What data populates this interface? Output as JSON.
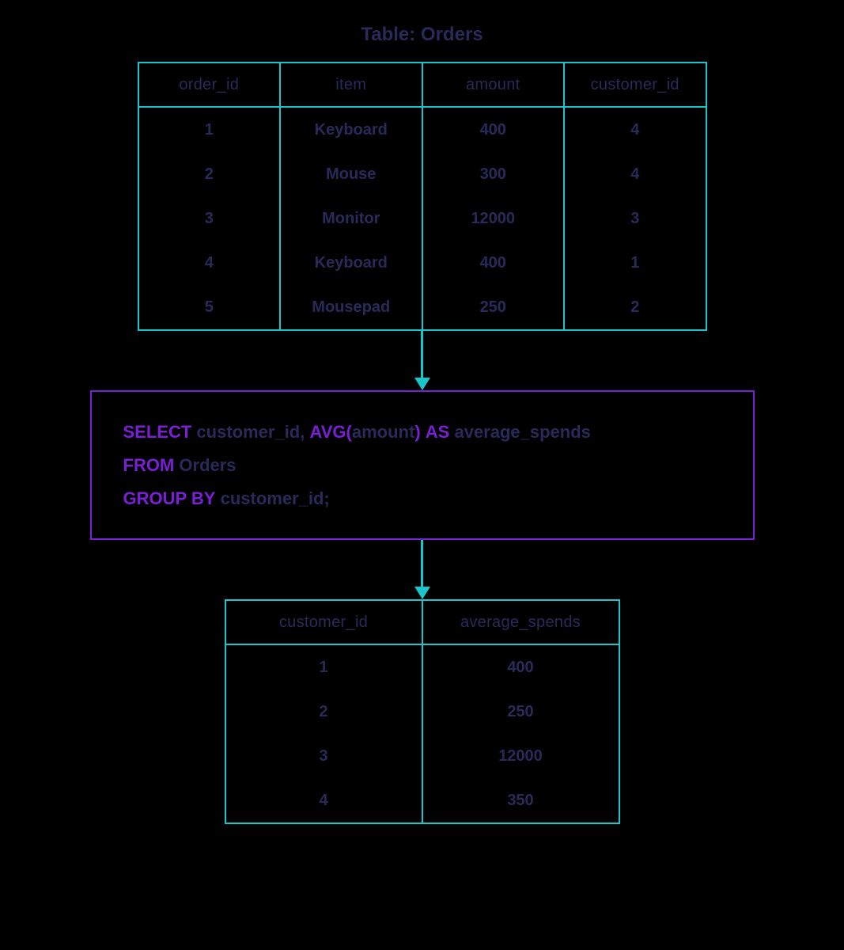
{
  "title": "Table: Orders",
  "orders_table": {
    "headers": [
      "order_id",
      "item",
      "amount",
      "customer_id"
    ],
    "rows": [
      [
        "1",
        "Keyboard",
        "400",
        "4"
      ],
      [
        "2",
        "Mouse",
        "300",
        "4"
      ],
      [
        "3",
        "Monitor",
        "12000",
        "3"
      ],
      [
        "4",
        "Keyboard",
        "400",
        "1"
      ],
      [
        "5",
        "Mousepad",
        "250",
        "2"
      ]
    ]
  },
  "sql": {
    "kw_select": "SELECT",
    "part1": "customer_id,",
    "kw_avg": "AVG",
    "part_open": "(",
    "part2": "amount",
    "part_close": ")",
    "kw_as": "AS",
    "part3": "average_spends",
    "kw_from": "FROM",
    "part4": "Orders",
    "kw_groupby": "GROUP BY",
    "part5": "customer_id;"
  },
  "result_table": {
    "headers": [
      "customer_id",
      "average_spends"
    ],
    "rows": [
      [
        "1",
        "400"
      ],
      [
        "2",
        "250"
      ],
      [
        "3",
        "12000"
      ],
      [
        "4",
        "350"
      ]
    ]
  },
  "chart_data": {
    "type": "table",
    "title": "SQL GROUP BY with AVG — Orders table and result",
    "source_table": {
      "name": "Orders",
      "columns": [
        "order_id",
        "item",
        "amount",
        "customer_id"
      ],
      "rows": [
        [
          1,
          "Keyboard",
          400,
          4
        ],
        [
          2,
          "Mouse",
          300,
          4
        ],
        [
          3,
          "Monitor",
          12000,
          3
        ],
        [
          4,
          "Keyboard",
          400,
          1
        ],
        [
          5,
          "Mousepad",
          250,
          2
        ]
      ]
    },
    "query": "SELECT customer_id, AVG(amount) AS average_spends FROM Orders GROUP BY customer_id;",
    "result": {
      "columns": [
        "customer_id",
        "average_spends"
      ],
      "rows": [
        [
          1,
          400
        ],
        [
          2,
          250
        ],
        [
          3,
          12000
        ],
        [
          4,
          350
        ]
      ]
    }
  }
}
